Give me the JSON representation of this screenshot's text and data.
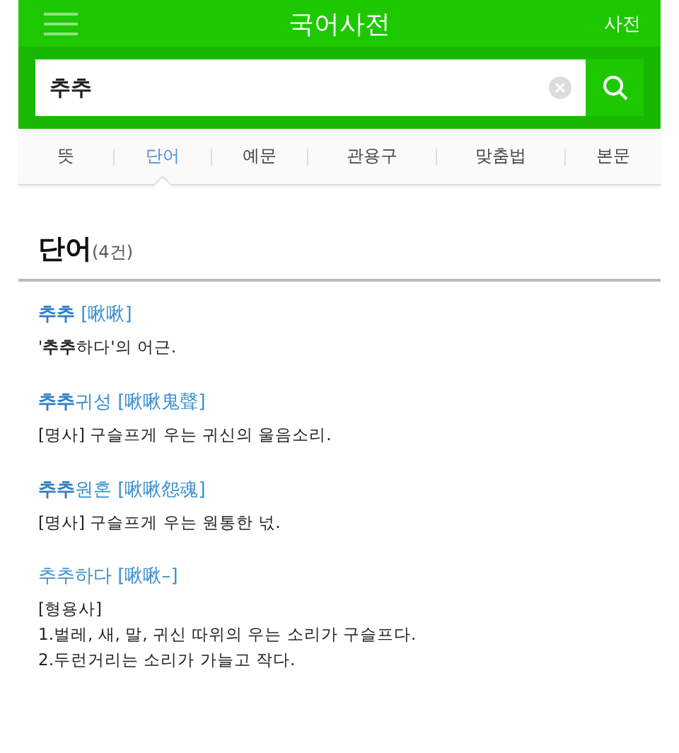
{
  "header": {
    "title": "국어사전",
    "right_link": "사전"
  },
  "search": {
    "value": "추추"
  },
  "tabs": [
    {
      "label": "뜻",
      "selected": false
    },
    {
      "label": "단어",
      "selected": true
    },
    {
      "label": "예문",
      "selected": false
    },
    {
      "label": "관용구",
      "selected": false
    },
    {
      "label": "맞춤법",
      "selected": false
    },
    {
      "label": "본문",
      "selected": false
    }
  ],
  "section": {
    "title": "단어",
    "count": "(4건)"
  },
  "entries": [
    {
      "headword": "**추추** [啾啾]",
      "lines": [
        "'**추추**하다'의 어근."
      ]
    },
    {
      "headword": "**추추**귀성 [啾啾鬼聲]",
      "lines": [
        "[명사] 구슬프게 우는 귀신의 울음소리."
      ]
    },
    {
      "headword": "**추추**원혼 [啾啾怨魂]",
      "lines": [
        "[명사] 구슬프게 우는 원통한 넋."
      ]
    },
    {
      "headword": "추추하다 [啾啾–]",
      "lines": [
        "[형용사]",
        "1.벌레, 새, 말, 귀신 따위의 우는 소리가 구슬프다.",
        "2.두런거리는 소리가 가늘고 작다."
      ]
    }
  ]
}
